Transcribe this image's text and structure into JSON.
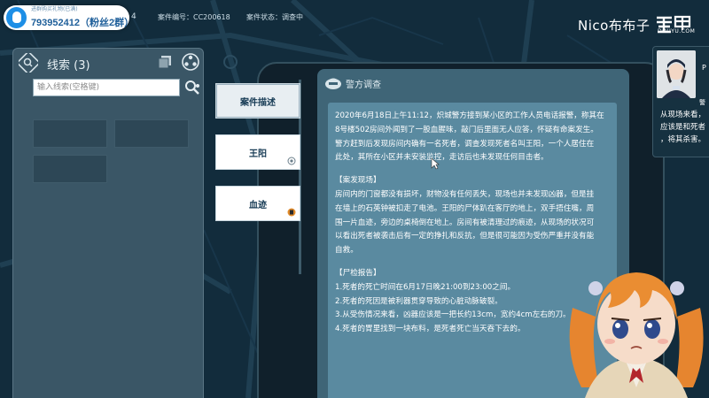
{
  "overlay": {
    "qq_sub": "进群购买礼物(已满)",
    "qq_number": "793952412（粉丝2群）",
    "top_digit": "4",
    "case_number": "案件编号：CC200618",
    "case_status": "案件状态：调查中",
    "streamer": "Nico布布子",
    "platform_sub": "DOUYU.COM"
  },
  "clues": {
    "title": "线索 (3)",
    "search_placeholder": "输入线索(空格键)"
  },
  "tabs": [
    {
      "label": "案件描述",
      "active": true
    },
    {
      "label": "王阳",
      "active": false
    },
    {
      "label": "血迹",
      "active": false
    }
  ],
  "document": {
    "title": "警方调查",
    "para1": [
      "2020年6月18日上午11:12，炽城警方接到某小区的工作人员电话报警，称其在",
      "8号楼502房间外闻到了一股血腥味，敲门后里面无人应答，怀疑有命案发生。",
      "警方赶到后发现房间内确有一名死者，调查发现死者名叫王阳，一个人居住在",
      "此处，其所在小区并未安装监控，走访后也未发现任何目击者。"
    ],
    "section2_title": "【案发现场】",
    "para2": [
      "房间内的门窗都没有损坏，财物没有任何丢失，现场也并未发现凶器，但是挂",
      "在墙上的石英钟被扣走了电池。王阳的尸体趴在客厅的地上，双手捂住嘴，周",
      "围一片血迹，旁边的桌椅倒在地上。房间有被清理过的痕迹，从现场的状况可",
      "以看出死者被袭击后有一定的挣扎和反抗，但是很可能因为受伤严重并没有能",
      "自救。"
    ],
    "section3_title": "【尸检报告】",
    "para3": [
      "1.死者的死亡时间在6月17日晚21:00到23:00之间。",
      "2.死者的死因是被利器贯穿导致的心脏动脉破裂。",
      "3.从受伤情况来看，凶器应该是一把长约13cm，宽约4cm左右的刀。",
      "4.死者的胃里找到一块布料，是死者死亡当天吞下去的。"
    ]
  },
  "side_card": {
    "name_partial": "警",
    "letter": "P",
    "lines": [
      "从现场来看，",
      "应该是和死者",
      "，将其杀害。"
    ]
  },
  "colors": {
    "panel": "#3a5666",
    "doc_body": "#5a8aa0",
    "tab_text": "#173b55",
    "background": "#122c3c"
  }
}
